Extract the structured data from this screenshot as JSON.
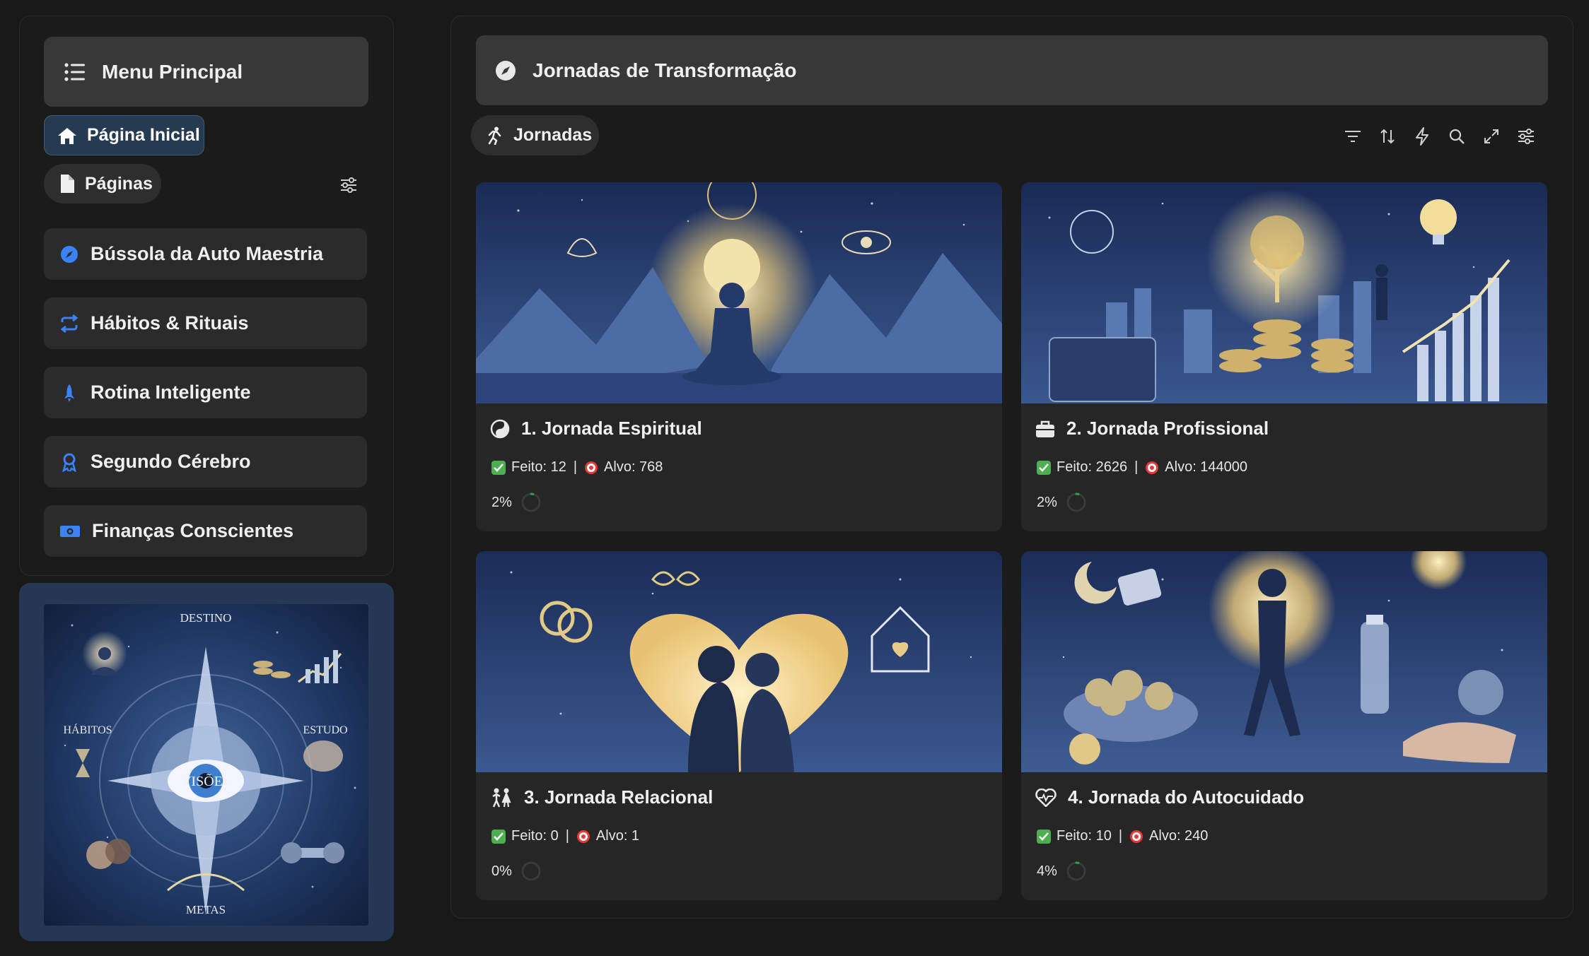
{
  "sidebar": {
    "menu_title": "Menu Principal",
    "home_label": "Página Inicial",
    "pages_label": "Páginas",
    "items": [
      {
        "label": "Bússola da Auto Maestria",
        "icon": "compass-icon"
      },
      {
        "label": "Hábitos & Rituais",
        "icon": "repeat-icon"
      },
      {
        "label": "Rotina Inteligente",
        "icon": "rocket-icon"
      },
      {
        "label": "Segundo Cérebro",
        "icon": "ribbon-icon"
      },
      {
        "label": "Finanças Conscientes",
        "icon": "money-icon"
      }
    ],
    "vision_board": {
      "top": "DESTINO",
      "left": "HÁBITOS",
      "right": "ESTUDO",
      "center": "VISÕES",
      "bottom": "METAS"
    }
  },
  "main": {
    "title": "Jornadas de Transformação",
    "view_tab": "Jornadas",
    "toolbar": [
      "filter-icon",
      "sort-icon",
      "lightning-icon",
      "search-icon",
      "expand-icon",
      "settings-icon"
    ],
    "cards": [
      {
        "title": "1. Jornada Espiritual",
        "icon": "yin-yang-icon",
        "feito_label": "Feito: 12",
        "alvo_label": "Alvo: 768",
        "percent_label": "2%",
        "progress": 0.02
      },
      {
        "title": "2. Jornada Profissional",
        "icon": "briefcase-icon",
        "feito_label": "Feito: 2626",
        "alvo_label": "Alvo: 144000",
        "percent_label": "2%",
        "progress": 0.02
      },
      {
        "title": "3. Jornada Relacional",
        "icon": "people-icon",
        "feito_label": "Feito: 0",
        "alvo_label": "Alvo: 1",
        "percent_label": "0%",
        "progress": 0.0
      },
      {
        "title": "4. Jornada do Autocuidado",
        "icon": "heart-pulse-icon",
        "feito_label": "Feito: 10",
        "alvo_label": "Alvo: 240",
        "percent_label": "4%",
        "progress": 0.04
      }
    ]
  },
  "colors": {
    "accent_blue": "#3b82f6",
    "check_green": "#4caf50",
    "progress_green": "#2e9e5a"
  }
}
